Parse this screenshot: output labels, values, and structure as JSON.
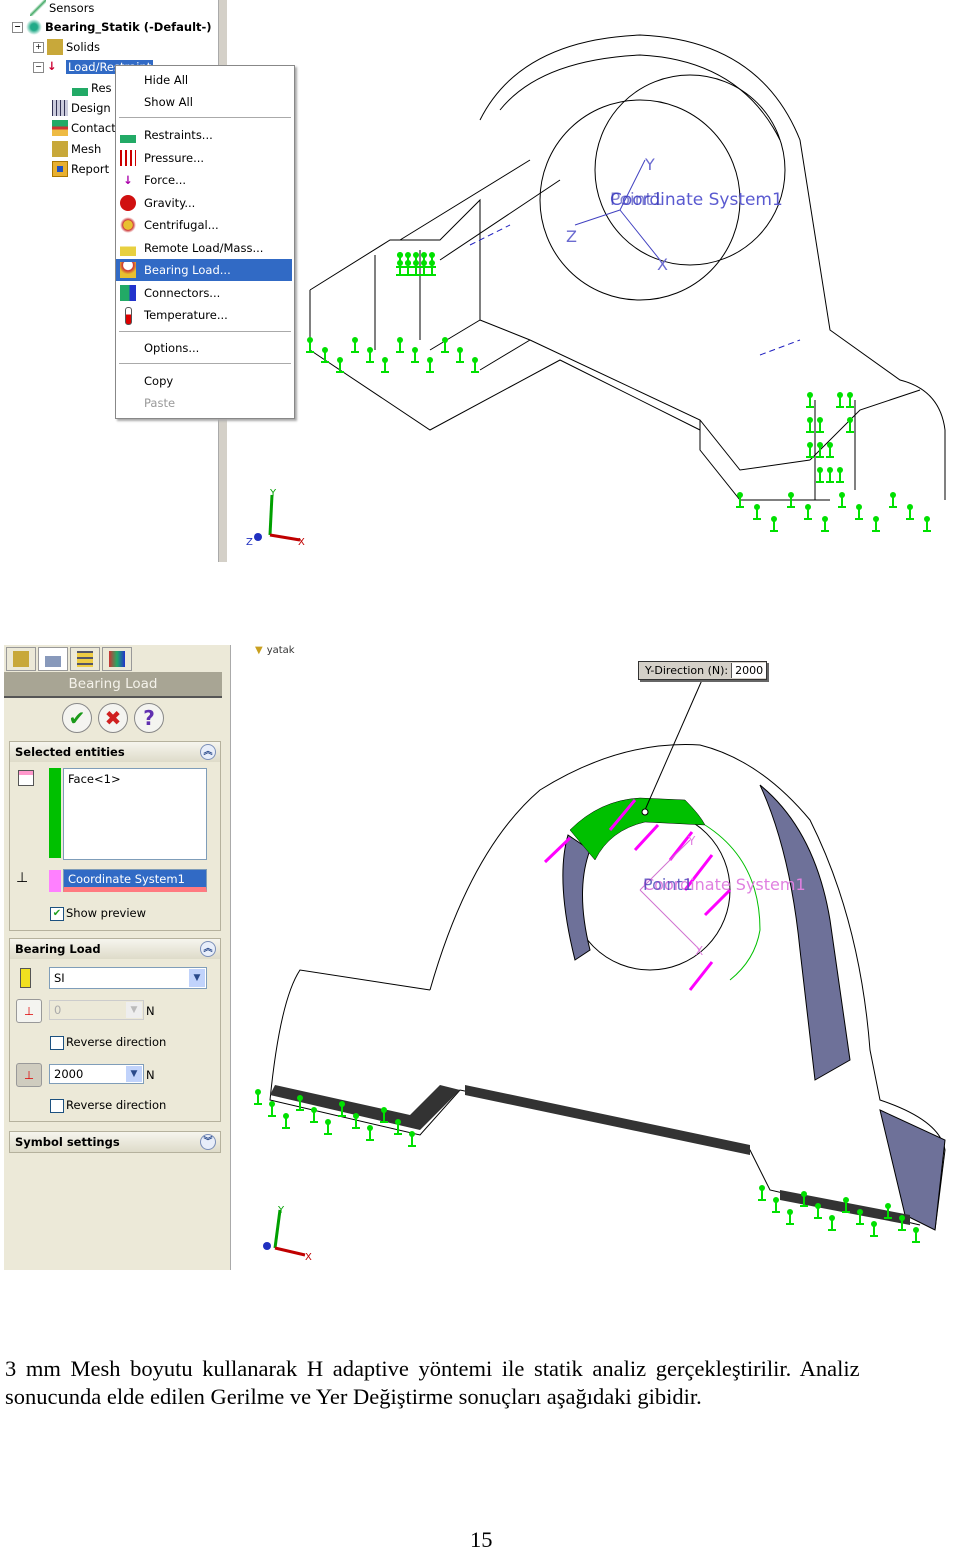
{
  "screenshot1": {
    "tree": {
      "items": [
        {
          "label": "Sensors"
        },
        {
          "label": "Bearing_Statik (-Default-)"
        },
        {
          "label": "Solids"
        },
        {
          "label": "Load/Restraint"
        },
        {
          "label": "Res"
        },
        {
          "label": "Design S"
        },
        {
          "label": "Contact"
        },
        {
          "label": "Mesh"
        },
        {
          "label": "Report"
        }
      ]
    },
    "context_menu": {
      "items": [
        {
          "label": "Hide All",
          "icon": "none"
        },
        {
          "label": "Show All",
          "icon": "none"
        },
        {
          "label": "Restraints...",
          "icon": "restraint-icon"
        },
        {
          "label": "Pressure...",
          "icon": "pressure-icon"
        },
        {
          "label": "Force...",
          "icon": "force-icon"
        },
        {
          "label": "Gravity...",
          "icon": "gravity-apple-icon"
        },
        {
          "label": "Centrifugal...",
          "icon": "centrifugal-icon"
        },
        {
          "label": "Remote Load/Mass...",
          "icon": "remote-load-icon"
        },
        {
          "label": "Bearing Load...",
          "icon": "bearing-load-icon",
          "selected": true
        },
        {
          "label": "Connectors...",
          "icon": "connectors-icon"
        },
        {
          "label": "Temperature...",
          "icon": "thermometer-icon"
        },
        {
          "label": "Options...",
          "icon": "none"
        },
        {
          "label": "Copy",
          "icon": "none"
        },
        {
          "label": "Paste",
          "icon": "none",
          "disabled": true
        }
      ]
    },
    "viewport": {
      "coordinate_label": "Coordinate System1",
      "point_label": "Point1",
      "axes": {
        "x": "X",
        "y": "Y",
        "z": "Z"
      }
    }
  },
  "screenshot2": {
    "tree_fragment": "yatak",
    "panel": {
      "title": "Bearing Load",
      "selected_entities": {
        "header": "Selected entities",
        "face": "Face<1>",
        "coordinate_system": "Coordinate System1",
        "show_preview_label": "Show preview",
        "show_preview_checked": true
      },
      "bearing_load": {
        "header": "Bearing Load",
        "units": "SI",
        "x_value": "0",
        "x_unit": "N",
        "reverse_x_label": "Reverse direction",
        "y_value": "2000",
        "y_unit": "N",
        "reverse_y_label": "Reverse direction"
      },
      "symbol_settings": {
        "header": "Symbol settings"
      }
    },
    "callout": {
      "label": "Y-Direction (N):",
      "value": "2000"
    },
    "viewport": {
      "coordinate_label": "Coordinate System1",
      "point_label": "Point1",
      "axes": {
        "x": "X",
        "y": "Y"
      }
    },
    "colors": {
      "selected_face": "#00c000",
      "load_arrows": "#ff00ff",
      "restraints": "#00e000",
      "shaded_faces": "#6e7199"
    }
  },
  "document": {
    "paragraph_line1": "3 mm Mesh boyutu kullanarak H adaptive yöntemi ile statik analiz gerçekleştirilir. Analiz",
    "paragraph_line2": "sonucunda elde edilen Gerilme ve Yer Değiştirme sonuçları aşağıdaki gibidir.",
    "page_number": "15"
  }
}
